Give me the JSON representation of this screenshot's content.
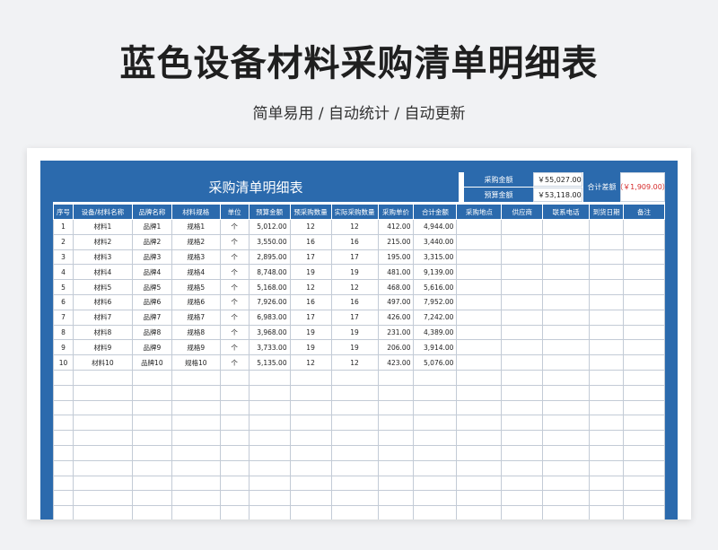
{
  "page": {
    "title": "蓝色设备材料采购清单明细表",
    "subtitle": "简单易用 / 自动统计 / 自动更新"
  },
  "sheet": {
    "banner_title": "采购清单明细表",
    "summary": {
      "purchase_amount_label": "采购金额",
      "purchase_amount_value": "￥55,027.00",
      "budget_amount_label": "预算金额",
      "budget_amount_value": "￥53,118.00",
      "total_diff_label": "合计差额",
      "total_diff_value": "（￥1,909.00）"
    },
    "columns": [
      "序号",
      "设备/材料名称",
      "品牌名称",
      "材料规格",
      "单位",
      "预算金额",
      "预采购数量",
      "实际采购数量",
      "采购单价",
      "合计金额",
      "采购地点",
      "供应商",
      "联系电话",
      "到货日期",
      "备注"
    ],
    "rows": [
      [
        "1",
        "材料1",
        "品牌1",
        "规格1",
        "个",
        "5,012.00",
        "12",
        "12",
        "412.00",
        "4,944.00",
        "",
        "",
        "",
        "",
        ""
      ],
      [
        "2",
        "材料2",
        "品牌2",
        "规格2",
        "个",
        "3,550.00",
        "16",
        "16",
        "215.00",
        "3,440.00",
        "",
        "",
        "",
        "",
        ""
      ],
      [
        "3",
        "材料3",
        "品牌3",
        "规格3",
        "个",
        "2,895.00",
        "17",
        "17",
        "195.00",
        "3,315.00",
        "",
        "",
        "",
        "",
        ""
      ],
      [
        "4",
        "材料4",
        "品牌4",
        "规格4",
        "个",
        "8,748.00",
        "19",
        "19",
        "481.00",
        "9,139.00",
        "",
        "",
        "",
        "",
        ""
      ],
      [
        "5",
        "材料5",
        "品牌5",
        "规格5",
        "个",
        "5,168.00",
        "12",
        "12",
        "468.00",
        "5,616.00",
        "",
        "",
        "",
        "",
        ""
      ],
      [
        "6",
        "材料6",
        "品牌6",
        "规格6",
        "个",
        "7,926.00",
        "16",
        "16",
        "497.00",
        "7,952.00",
        "",
        "",
        "",
        "",
        ""
      ],
      [
        "7",
        "材料7",
        "品牌7",
        "规格7",
        "个",
        "6,983.00",
        "17",
        "17",
        "426.00",
        "7,242.00",
        "",
        "",
        "",
        "",
        ""
      ],
      [
        "8",
        "材料8",
        "品牌8",
        "规格8",
        "个",
        "3,968.00",
        "19",
        "19",
        "231.00",
        "4,389.00",
        "",
        "",
        "",
        "",
        ""
      ],
      [
        "9",
        "材料9",
        "品牌9",
        "规格9",
        "个",
        "3,733.00",
        "19",
        "19",
        "206.00",
        "3,914.00",
        "",
        "",
        "",
        "",
        ""
      ],
      [
        "10",
        "材料10",
        "品牌10",
        "规格10",
        "个",
        "5,135.00",
        "12",
        "12",
        "423.00",
        "5,076.00",
        "",
        "",
        "",
        "",
        ""
      ],
      [
        "",
        "",
        "",
        "",
        "",
        "",
        "",
        "",
        "",
        "",
        "",
        "",
        "",
        "",
        ""
      ],
      [
        "",
        "",
        "",
        "",
        "",
        "",
        "",
        "",
        "",
        "",
        "",
        "",
        "",
        "",
        ""
      ],
      [
        "",
        "",
        "",
        "",
        "",
        "",
        "",
        "",
        "",
        "",
        "",
        "",
        "",
        "",
        ""
      ],
      [
        "",
        "",
        "",
        "",
        "",
        "",
        "",
        "",
        "",
        "",
        "",
        "",
        "",
        "",
        ""
      ],
      [
        "",
        "",
        "",
        "",
        "",
        "",
        "",
        "",
        "",
        "",
        "",
        "",
        "",
        "",
        ""
      ],
      [
        "",
        "",
        "",
        "",
        "",
        "",
        "",
        "",
        "",
        "",
        "",
        "",
        "",
        "",
        ""
      ],
      [
        "",
        "",
        "",
        "",
        "",
        "",
        "",
        "",
        "",
        "",
        "",
        "",
        "",
        "",
        ""
      ],
      [
        "",
        "",
        "",
        "",
        "",
        "",
        "",
        "",
        "",
        "",
        "",
        "",
        "",
        "",
        ""
      ],
      [
        "",
        "",
        "",
        "",
        "",
        "",
        "",
        "",
        "",
        "",
        "",
        "",
        "",
        "",
        ""
      ],
      [
        "",
        "",
        "",
        "",
        "",
        "",
        "",
        "",
        "",
        "",
        "",
        "",
        "",
        "",
        ""
      ]
    ]
  }
}
